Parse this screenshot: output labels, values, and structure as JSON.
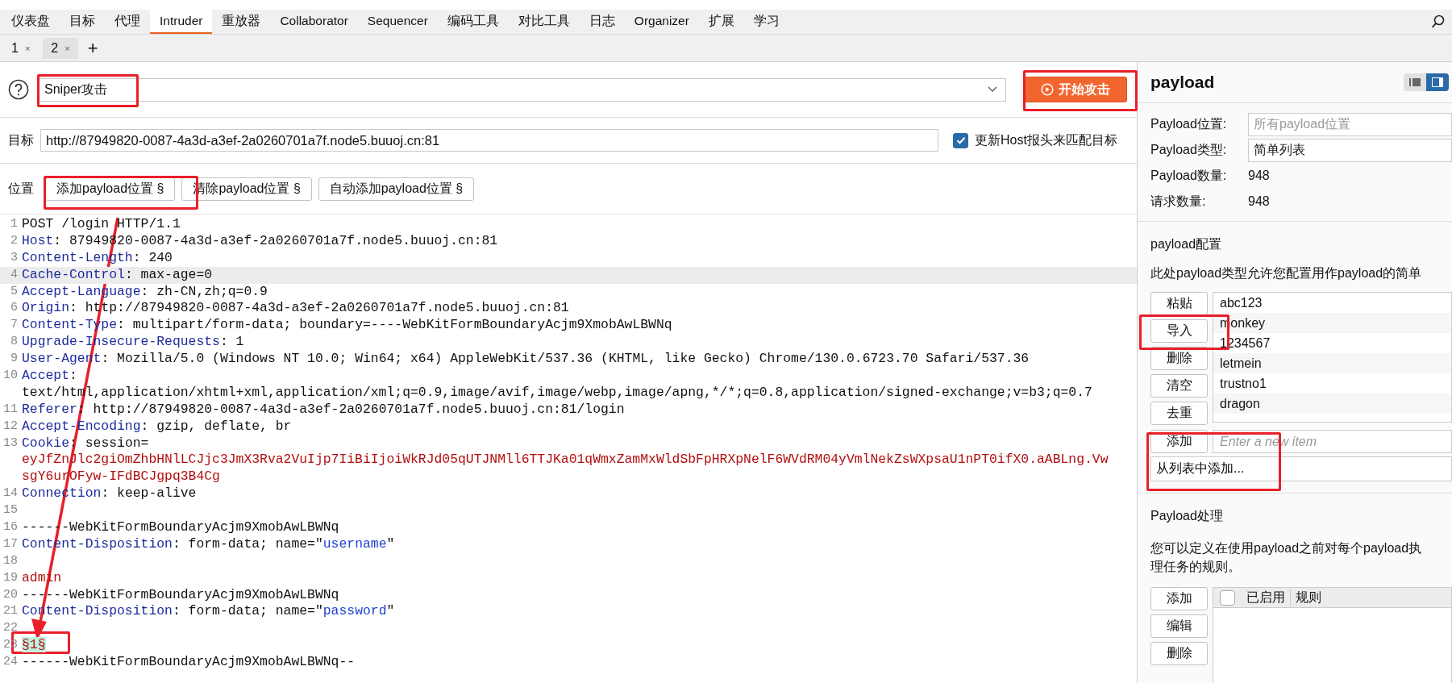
{
  "main_tabs": [
    {
      "label": "仪表盘",
      "selected": false
    },
    {
      "label": "目标",
      "selected": false
    },
    {
      "label": "代理",
      "selected": false
    },
    {
      "label": "Intruder",
      "selected": true
    },
    {
      "label": "重放器",
      "selected": false
    },
    {
      "label": "Collaborator",
      "selected": false
    },
    {
      "label": "Sequencer",
      "selected": false
    },
    {
      "label": "编码工具",
      "selected": false
    },
    {
      "label": "对比工具",
      "selected": false
    },
    {
      "label": "日志",
      "selected": false
    },
    {
      "label": "Organizer",
      "selected": false
    },
    {
      "label": "扩展",
      "selected": false
    },
    {
      "label": "学习",
      "selected": false
    }
  ],
  "sub_tabs": {
    "tabs": [
      {
        "label": "1",
        "close": "×",
        "selected": false
      },
      {
        "label": "2",
        "close": "×",
        "selected": true
      }
    ],
    "add": "+"
  },
  "attack": {
    "type": "Sniper攻击",
    "start_button": "开始攻击"
  },
  "target": {
    "label": "目标",
    "url": "http://87949820-0087-4a3d-a3ef-2a0260701a7f.node5.buuoj.cn:81",
    "update_host": {
      "label": "更新Host报头来匹配目标",
      "checked": true
    }
  },
  "positions": {
    "label": "位置",
    "buttons": [
      "添加payload位置 §",
      "清除payload位置 §",
      "自动添加payload位置 §"
    ]
  },
  "editor": {
    "lines": [
      {
        "number": "1",
        "highlighted": false,
        "rows": [
          [
            {
              "kind": "plain",
              "text": "POST /login HTTP/1.1"
            }
          ]
        ]
      },
      {
        "number": "2",
        "highlighted": false,
        "rows": [
          [
            {
              "kind": "name",
              "text": "Host"
            },
            {
              "kind": "plain",
              "text": ": 87949820-0087-4a3d-a3ef-2a0260701a7f.node5.buuoj.cn:81"
            }
          ]
        ]
      },
      {
        "number": "3",
        "highlighted": false,
        "rows": [
          [
            {
              "kind": "name",
              "text": "Content-Length"
            },
            {
              "kind": "plain",
              "text": ": 240"
            }
          ]
        ]
      },
      {
        "number": "4",
        "highlighted": true,
        "rows": [
          [
            {
              "kind": "name",
              "text": "Cache-Control"
            },
            {
              "kind": "plain",
              "text": ": max-age=0"
            }
          ]
        ]
      },
      {
        "number": "5",
        "highlighted": false,
        "rows": [
          [
            {
              "kind": "name",
              "text": "Accept-Language"
            },
            {
              "kind": "plain",
              "text": ": zh-CN,zh;q=0.9"
            }
          ]
        ]
      },
      {
        "number": "6",
        "highlighted": false,
        "rows": [
          [
            {
              "kind": "name",
              "text": "Origin"
            },
            {
              "kind": "plain",
              "text": ": http://87949820-0087-4a3d-a3ef-2a0260701a7f.node5.buuoj.cn:81"
            }
          ]
        ]
      },
      {
        "number": "7",
        "highlighted": false,
        "rows": [
          [
            {
              "kind": "name",
              "text": "Content-Type"
            },
            {
              "kind": "plain",
              "text": ": multipart/form-data; boundary=----WebKitFormBoundaryAcjm9XmobAwLBWNq"
            }
          ]
        ]
      },
      {
        "number": "8",
        "highlighted": false,
        "rows": [
          [
            {
              "kind": "name",
              "text": "Upgrade-Insecure-Requests"
            },
            {
              "kind": "plain",
              "text": ": 1"
            }
          ]
        ]
      },
      {
        "number": "9",
        "highlighted": false,
        "rows": [
          [
            {
              "kind": "name",
              "text": "User-Agent"
            },
            {
              "kind": "plain",
              "text": ": Mozilla/5.0 (Windows NT 10.0; Win64; x64) AppleWebKit/537.36 (KHTML, like Gecko) Chrome/130.0.6723.70 Safari/537.36"
            }
          ]
        ]
      },
      {
        "number": "10",
        "highlighted": false,
        "rows": [
          [
            {
              "kind": "name",
              "text": "Accept"
            },
            {
              "kind": "plain",
              "text": ":"
            }
          ],
          [
            {
              "kind": "plain",
              "text": "text/html,application/xhtml+xml,application/xml;q=0.9,image/avif,image/webp,image/apng,*/*;q=0.8,application/signed-exchange;v=b3;q=0.7"
            }
          ]
        ]
      },
      {
        "number": "11",
        "highlighted": false,
        "rows": [
          [
            {
              "kind": "name",
              "text": "Referer"
            },
            {
              "kind": "plain",
              "text": ": http://87949820-0087-4a3d-a3ef-2a0260701a7f.node5.buuoj.cn:81/login"
            }
          ]
        ]
      },
      {
        "number": "12",
        "highlighted": false,
        "rows": [
          [
            {
              "kind": "name",
              "text": "Accept-Encoding"
            },
            {
              "kind": "plain",
              "text": ": gzip, deflate, br"
            }
          ]
        ]
      },
      {
        "number": "13",
        "highlighted": false,
        "rows": [
          [
            {
              "kind": "name",
              "text": "Cookie"
            },
            {
              "kind": "plain",
              "text": ": session="
            }
          ],
          [
            {
              "kind": "cookie",
              "text": "eyJfZnJlc2giOmZhbHNlLCJjc3JmX3Rva2VuIjp7IiBiIjoiWkRJd05qUTJNMll6TTJKa01qWmxZamMxWldSbFpHRXpNelF6WVdRM04yVmlNekZsWXpsaU1nPT0ifX0.aABLng.Vw"
            }
          ],
          [
            {
              "kind": "cookie",
              "text": "sgY6urOFyw-IFdBCJgpq3B4Cg"
            }
          ]
        ]
      },
      {
        "number": "14",
        "highlighted": false,
        "rows": [
          [
            {
              "kind": "name",
              "text": "Connection"
            },
            {
              "kind": "plain",
              "text": ": keep-alive"
            }
          ]
        ]
      },
      {
        "number": "15",
        "highlighted": false,
        "rows": [
          []
        ]
      },
      {
        "number": "16",
        "highlighted": false,
        "rows": [
          [
            {
              "kind": "plain",
              "text": "------WebKitFormBoundaryAcjm9XmobAwLBWNq"
            }
          ]
        ]
      },
      {
        "number": "17",
        "highlighted": false,
        "rows": [
          [
            {
              "kind": "name",
              "text": "Content-Disposition"
            },
            {
              "kind": "plain",
              "text": ": form-data; name=\""
            },
            {
              "kind": "string",
              "text": "username"
            },
            {
              "kind": "plain",
              "text": "\""
            }
          ]
        ]
      },
      {
        "number": "18",
        "highlighted": false,
        "rows": [
          []
        ]
      },
      {
        "number": "19",
        "highlighted": false,
        "rows": [
          [
            {
              "kind": "cookie",
              "text": "admin"
            }
          ]
        ]
      },
      {
        "number": "20",
        "highlighted": false,
        "rows": [
          [
            {
              "kind": "plain",
              "text": "------WebKitFormBoundaryAcjm9XmobAwLBWNq"
            }
          ]
        ]
      },
      {
        "number": "21",
        "highlighted": false,
        "rows": [
          [
            {
              "kind": "name",
              "text": "Content-Disposition"
            },
            {
              "kind": "plain",
              "text": ": form-data; name=\""
            },
            {
              "kind": "string",
              "text": "password"
            },
            {
              "kind": "plain",
              "text": "\""
            }
          ]
        ]
      },
      {
        "number": "22",
        "highlighted": false,
        "rows": [
          []
        ]
      },
      {
        "number": "23",
        "highlighted": false,
        "rows": [
          [
            {
              "kind": "marker",
              "text": "§1§"
            }
          ]
        ]
      },
      {
        "number": "24",
        "highlighted": false,
        "rows": [
          [
            {
              "kind": "plain",
              "text": "------WebKitFormBoundaryAcjm9XmobAwLBWNq--"
            }
          ]
        ]
      }
    ]
  },
  "payload_panel": {
    "title": "payload",
    "views": [
      {
        "kind": "list",
        "selected": false
      },
      {
        "kind": "split",
        "selected": true
      }
    ],
    "fields": [
      {
        "label": "Payload位置:",
        "placeholder": "所有payload位置",
        "kind": "select"
      },
      {
        "label": "Payload类型:",
        "value": "简单列表",
        "kind": "select"
      },
      {
        "label": "Payload数量:",
        "value": "948",
        "kind": "text"
      },
      {
        "label": "请求数量:",
        "value": "948",
        "kind": "text"
      }
    ],
    "config": {
      "title": "payload配置",
      "description": "此处payload类型允许您配置用作payload的简单",
      "buttons": [
        "粘贴",
        "导入",
        "删除",
        "清空",
        "去重"
      ],
      "items": [
        "abc123",
        "monkey",
        "1234567",
        "letmein",
        "trustno1",
        "dragon"
      ],
      "add_button": "添加",
      "new_item_placeholder": "Enter a new item",
      "add_from_list": "从列表中添加..."
    },
    "processing": {
      "title": "Payload处理",
      "description": [
        "您可以定义在使用payload之前对每个payload执",
        "理任务的规则。"
      ],
      "buttons": [
        "添加",
        "编辑",
        "删除"
      ],
      "columns": [
        {
          "label": "已启用",
          "checked": false
        },
        {
          "label": "规则"
        }
      ]
    }
  }
}
